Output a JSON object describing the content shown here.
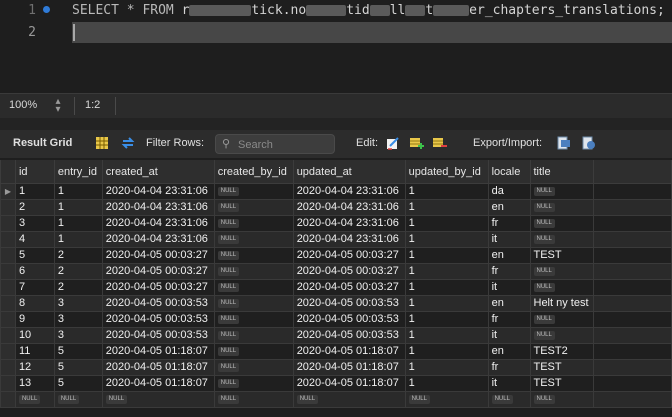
{
  "editor": {
    "lines": [
      {
        "num": "1",
        "code_parts": {
          "kw": "SELECT * FROM",
          "r1": "r",
          "a1": "tick.no",
          "a2": "tid",
          "a3": "ll",
          "a4": "t",
          "tail": "er_chapters_translations;"
        }
      },
      {
        "num": "2"
      }
    ]
  },
  "statusbar": {
    "zoom": "100%",
    "position": "1:2"
  },
  "toolbar": {
    "result_grid": "Result Grid",
    "filter_rows": "Filter Rows:",
    "search_placeholder": "Search",
    "edit": "Edit:",
    "export_import": "Export/Import:"
  },
  "grid": {
    "null_label": "NULL",
    "columns": [
      "id",
      "entry_id",
      "created_at",
      "created_by_id",
      "updated_at",
      "updated_by_id",
      "locale",
      "title"
    ],
    "rows": [
      [
        "1",
        "1",
        "2020-04-04 23:31:06",
        null,
        "2020-04-04 23:31:06",
        "1",
        "da",
        null
      ],
      [
        "2",
        "1",
        "2020-04-04 23:31:06",
        null,
        "2020-04-04 23:31:06",
        "1",
        "en",
        null
      ],
      [
        "3",
        "1",
        "2020-04-04 23:31:06",
        null,
        "2020-04-04 23:31:06",
        "1",
        "fr",
        null
      ],
      [
        "4",
        "1",
        "2020-04-04 23:31:06",
        null,
        "2020-04-04 23:31:06",
        "1",
        "it",
        null
      ],
      [
        "5",
        "2",
        "2020-04-05 00:03:27",
        null,
        "2020-04-05 00:03:27",
        "1",
        "en",
        "TEST"
      ],
      [
        "6",
        "2",
        "2020-04-05 00:03:27",
        null,
        "2020-04-05 00:03:27",
        "1",
        "fr",
        null
      ],
      [
        "7",
        "2",
        "2020-04-05 00:03:27",
        null,
        "2020-04-05 00:03:27",
        "1",
        "it",
        null
      ],
      [
        "8",
        "3",
        "2020-04-05 00:03:53",
        null,
        "2020-04-05 00:03:53",
        "1",
        "en",
        "Helt ny test"
      ],
      [
        "9",
        "3",
        "2020-04-05 00:03:53",
        null,
        "2020-04-05 00:03:53",
        "1",
        "fr",
        null
      ],
      [
        "10",
        "3",
        "2020-04-05 00:03:53",
        null,
        "2020-04-05 00:03:53",
        "1",
        "it",
        null
      ],
      [
        "11",
        "5",
        "2020-04-05 01:18:07",
        null,
        "2020-04-05 01:18:07",
        "1",
        "en",
        "TEST2"
      ],
      [
        "12",
        "5",
        "2020-04-05 01:18:07",
        null,
        "2020-04-05 01:18:07",
        "1",
        "fr",
        "TEST"
      ],
      [
        "13",
        "5",
        "2020-04-05 01:18:07",
        null,
        "2020-04-05 01:18:07",
        "1",
        "it",
        "TEST"
      ],
      [
        null,
        null,
        null,
        null,
        null,
        null,
        null,
        null
      ]
    ]
  },
  "colors": {
    "background": "#1e1e1e",
    "breakpoint": "#2f7bd8",
    "cursor_line": "#474747"
  }
}
